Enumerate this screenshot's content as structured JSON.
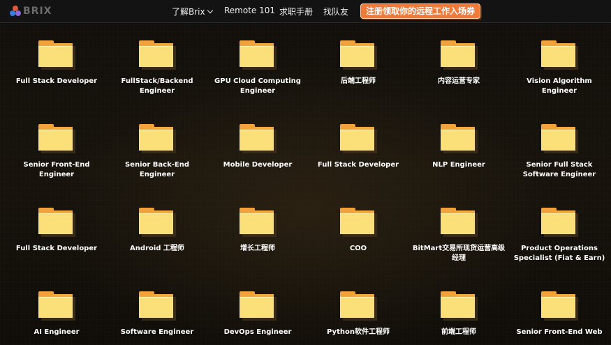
{
  "header": {
    "logo_text": "BRIX",
    "nav": {
      "about": "了解Brix",
      "remote101": "Remote 101",
      "handbook": "求职手册",
      "find_team": "找队友"
    },
    "cta_label": "注册领取你的远程工作入场券"
  },
  "colors": {
    "cta_background": "#f07a3a",
    "folder_front": "#fbe07a",
    "folder_back": "#f3a93c",
    "page_background": "#100d09"
  },
  "folders": [
    "Full Stack Developer",
    "FullStack/Backend Engineer",
    "GPU Cloud Computing Engineer",
    "后端工程师",
    "内容运营专家",
    "Vision Algorithm Engineer",
    "Senior Front-End Engineer",
    "Senior Back-End Engineer",
    "Mobile Developer",
    "Full Stack Developer",
    "NLP Engineer",
    "Senior Full Stack Software Engineer",
    "Full Stack Developer",
    "Android 工程师",
    "增长工程师",
    "COO",
    "BitMart交易所现货运营高级经理",
    "Product Operations Specialist (Fiat & Earn)",
    "AI Engineer",
    "Software Engineer",
    "DevOps Engineer",
    "Python软件工程师",
    "前端工程师",
    "Senior Front-End Web"
  ]
}
